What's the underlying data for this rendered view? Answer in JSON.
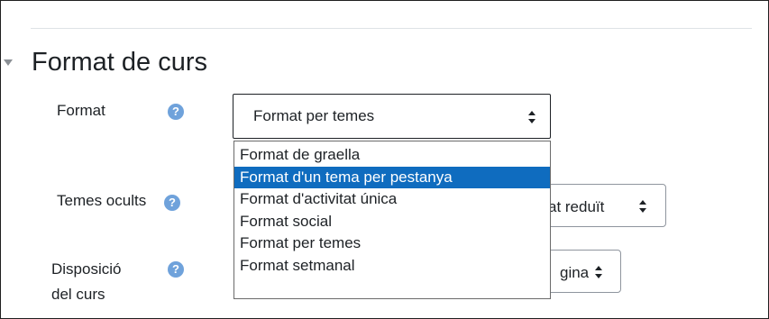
{
  "section": {
    "title": "Format de curs"
  },
  "fields": {
    "format": {
      "label": "Format",
      "help_icon": "question-circle-icon",
      "selected": "Format per temes",
      "options": [
        "Format de graella",
        "Format d'un tema per pestanya",
        "Format d'activitat única",
        "Format social",
        "Format per temes",
        "Format setmanal"
      ],
      "highlighted_option": "Format d'un tema per pestanya"
    },
    "hidden_sections": {
      "label": "Temes ocults",
      "help_icon": "question-circle-icon",
      "visible_value_fragment": "at reduït"
    },
    "course_layout": {
      "label_line1": "Disposició",
      "label_line2": "del curs",
      "help_icon": "question-circle-icon",
      "visible_value_fragment": "gina"
    }
  },
  "colors": {
    "help_icon": "#6fa2db",
    "highlight": "#0f6cbf",
    "text": "#1d2125"
  }
}
